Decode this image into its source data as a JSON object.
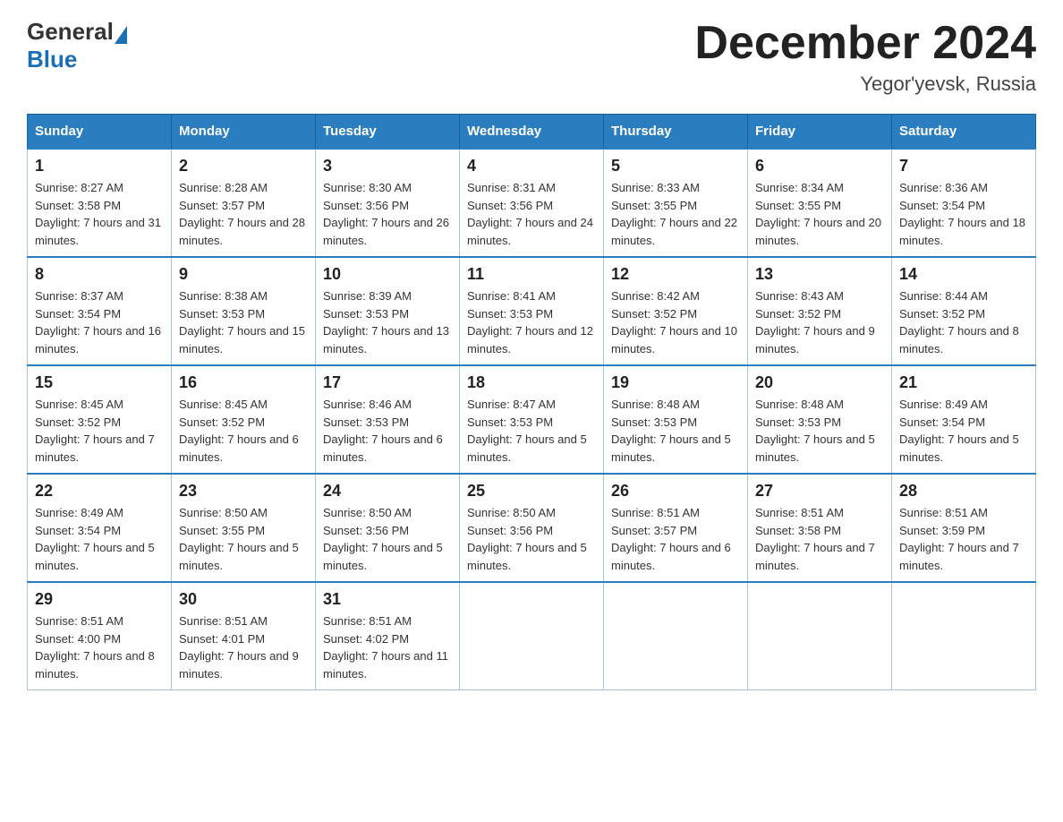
{
  "header": {
    "title": "December 2024",
    "subtitle": "Yegor'yevsk, Russia",
    "logo_general": "General",
    "logo_blue": "Blue"
  },
  "days_of_week": [
    "Sunday",
    "Monday",
    "Tuesday",
    "Wednesday",
    "Thursday",
    "Friday",
    "Saturday"
  ],
  "weeks": [
    [
      {
        "day": "1",
        "sunrise": "Sunrise: 8:27 AM",
        "sunset": "Sunset: 3:58 PM",
        "daylight": "Daylight: 7 hours and 31 minutes."
      },
      {
        "day": "2",
        "sunrise": "Sunrise: 8:28 AM",
        "sunset": "Sunset: 3:57 PM",
        "daylight": "Daylight: 7 hours and 28 minutes."
      },
      {
        "day": "3",
        "sunrise": "Sunrise: 8:30 AM",
        "sunset": "Sunset: 3:56 PM",
        "daylight": "Daylight: 7 hours and 26 minutes."
      },
      {
        "day": "4",
        "sunrise": "Sunrise: 8:31 AM",
        "sunset": "Sunset: 3:56 PM",
        "daylight": "Daylight: 7 hours and 24 minutes."
      },
      {
        "day": "5",
        "sunrise": "Sunrise: 8:33 AM",
        "sunset": "Sunset: 3:55 PM",
        "daylight": "Daylight: 7 hours and 22 minutes."
      },
      {
        "day": "6",
        "sunrise": "Sunrise: 8:34 AM",
        "sunset": "Sunset: 3:55 PM",
        "daylight": "Daylight: 7 hours and 20 minutes."
      },
      {
        "day": "7",
        "sunrise": "Sunrise: 8:36 AM",
        "sunset": "Sunset: 3:54 PM",
        "daylight": "Daylight: 7 hours and 18 minutes."
      }
    ],
    [
      {
        "day": "8",
        "sunrise": "Sunrise: 8:37 AM",
        "sunset": "Sunset: 3:54 PM",
        "daylight": "Daylight: 7 hours and 16 minutes."
      },
      {
        "day": "9",
        "sunrise": "Sunrise: 8:38 AM",
        "sunset": "Sunset: 3:53 PM",
        "daylight": "Daylight: 7 hours and 15 minutes."
      },
      {
        "day": "10",
        "sunrise": "Sunrise: 8:39 AM",
        "sunset": "Sunset: 3:53 PM",
        "daylight": "Daylight: 7 hours and 13 minutes."
      },
      {
        "day": "11",
        "sunrise": "Sunrise: 8:41 AM",
        "sunset": "Sunset: 3:53 PM",
        "daylight": "Daylight: 7 hours and 12 minutes."
      },
      {
        "day": "12",
        "sunrise": "Sunrise: 8:42 AM",
        "sunset": "Sunset: 3:52 PM",
        "daylight": "Daylight: 7 hours and 10 minutes."
      },
      {
        "day": "13",
        "sunrise": "Sunrise: 8:43 AM",
        "sunset": "Sunset: 3:52 PM",
        "daylight": "Daylight: 7 hours and 9 minutes."
      },
      {
        "day": "14",
        "sunrise": "Sunrise: 8:44 AM",
        "sunset": "Sunset: 3:52 PM",
        "daylight": "Daylight: 7 hours and 8 minutes."
      }
    ],
    [
      {
        "day": "15",
        "sunrise": "Sunrise: 8:45 AM",
        "sunset": "Sunset: 3:52 PM",
        "daylight": "Daylight: 7 hours and 7 minutes."
      },
      {
        "day": "16",
        "sunrise": "Sunrise: 8:45 AM",
        "sunset": "Sunset: 3:52 PM",
        "daylight": "Daylight: 7 hours and 6 minutes."
      },
      {
        "day": "17",
        "sunrise": "Sunrise: 8:46 AM",
        "sunset": "Sunset: 3:53 PM",
        "daylight": "Daylight: 7 hours and 6 minutes."
      },
      {
        "day": "18",
        "sunrise": "Sunrise: 8:47 AM",
        "sunset": "Sunset: 3:53 PM",
        "daylight": "Daylight: 7 hours and 5 minutes."
      },
      {
        "day": "19",
        "sunrise": "Sunrise: 8:48 AM",
        "sunset": "Sunset: 3:53 PM",
        "daylight": "Daylight: 7 hours and 5 minutes."
      },
      {
        "day": "20",
        "sunrise": "Sunrise: 8:48 AM",
        "sunset": "Sunset: 3:53 PM",
        "daylight": "Daylight: 7 hours and 5 minutes."
      },
      {
        "day": "21",
        "sunrise": "Sunrise: 8:49 AM",
        "sunset": "Sunset: 3:54 PM",
        "daylight": "Daylight: 7 hours and 5 minutes."
      }
    ],
    [
      {
        "day": "22",
        "sunrise": "Sunrise: 8:49 AM",
        "sunset": "Sunset: 3:54 PM",
        "daylight": "Daylight: 7 hours and 5 minutes."
      },
      {
        "day": "23",
        "sunrise": "Sunrise: 8:50 AM",
        "sunset": "Sunset: 3:55 PM",
        "daylight": "Daylight: 7 hours and 5 minutes."
      },
      {
        "day": "24",
        "sunrise": "Sunrise: 8:50 AM",
        "sunset": "Sunset: 3:56 PM",
        "daylight": "Daylight: 7 hours and 5 minutes."
      },
      {
        "day": "25",
        "sunrise": "Sunrise: 8:50 AM",
        "sunset": "Sunset: 3:56 PM",
        "daylight": "Daylight: 7 hours and 5 minutes."
      },
      {
        "day": "26",
        "sunrise": "Sunrise: 8:51 AM",
        "sunset": "Sunset: 3:57 PM",
        "daylight": "Daylight: 7 hours and 6 minutes."
      },
      {
        "day": "27",
        "sunrise": "Sunrise: 8:51 AM",
        "sunset": "Sunset: 3:58 PM",
        "daylight": "Daylight: 7 hours and 7 minutes."
      },
      {
        "day": "28",
        "sunrise": "Sunrise: 8:51 AM",
        "sunset": "Sunset: 3:59 PM",
        "daylight": "Daylight: 7 hours and 7 minutes."
      }
    ],
    [
      {
        "day": "29",
        "sunrise": "Sunrise: 8:51 AM",
        "sunset": "Sunset: 4:00 PM",
        "daylight": "Daylight: 7 hours and 8 minutes."
      },
      {
        "day": "30",
        "sunrise": "Sunrise: 8:51 AM",
        "sunset": "Sunset: 4:01 PM",
        "daylight": "Daylight: 7 hours and 9 minutes."
      },
      {
        "day": "31",
        "sunrise": "Sunrise: 8:51 AM",
        "sunset": "Sunset: 4:02 PM",
        "daylight": "Daylight: 7 hours and 11 minutes."
      },
      {
        "day": "",
        "sunrise": "",
        "sunset": "",
        "daylight": ""
      },
      {
        "day": "",
        "sunrise": "",
        "sunset": "",
        "daylight": ""
      },
      {
        "day": "",
        "sunrise": "",
        "sunset": "",
        "daylight": ""
      },
      {
        "day": "",
        "sunrise": "",
        "sunset": "",
        "daylight": ""
      }
    ]
  ]
}
